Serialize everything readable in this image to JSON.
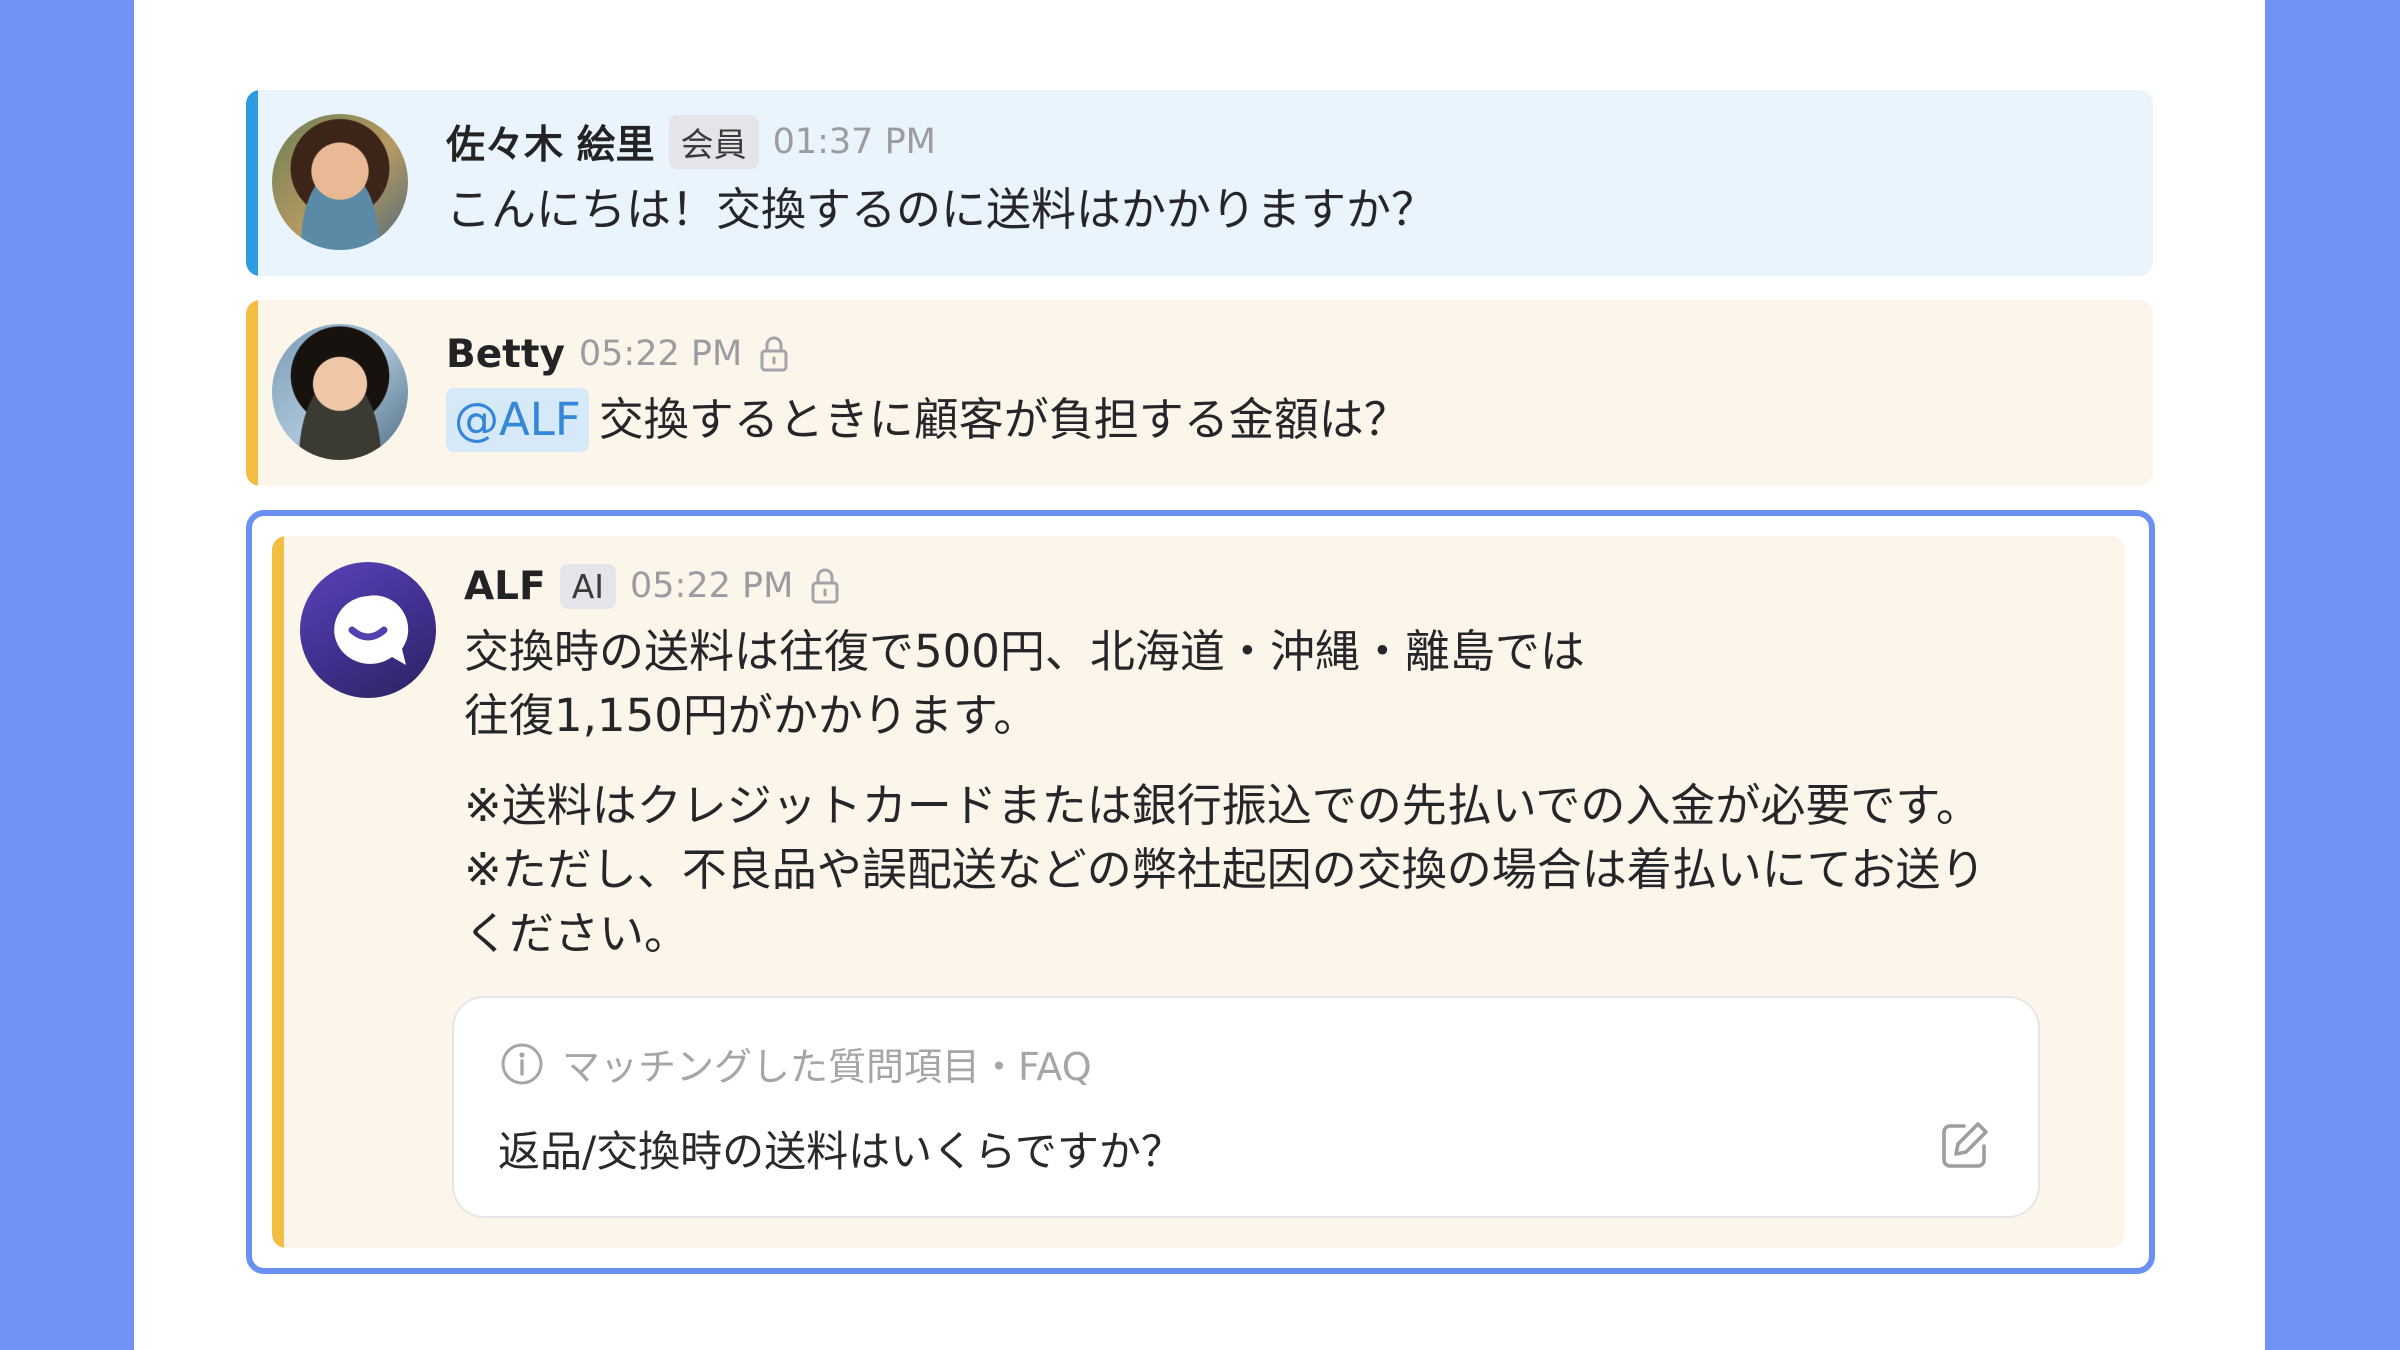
{
  "messages": [
    {
      "author": "佐々木 絵里",
      "badge": "会員",
      "time": "01:37 PM",
      "text": "こんにちは！交換するのに送料はかかりますか？"
    },
    {
      "author": "Betty",
      "time": "05:22 PM",
      "mention": "@ALF",
      "text": "交換するときに顧客が負担する金額は？"
    }
  ],
  "ai_reply": {
    "author": "ALF",
    "badge": "AI",
    "time": "05:22 PM",
    "line1": "交換時の送料は往復で500円、北海道・沖縄・離島では",
    "line2": "往復1,150円がかかります。",
    "note1": "※送料はクレジットカードまたは銀行振込での先払いでの入金が必要です。",
    "note2": "※ただし、不良品や誤配送などの弊社起因の交換の場合は着払いにてお送り",
    "note3": "ください。",
    "faq": {
      "label": "マッチングした質問項目・FAQ",
      "question": "返品/交換時の送料はいくらですか？"
    }
  },
  "colors": {
    "background": "#6f92f4",
    "customer_bar": "#2d9be2",
    "internal_bar": "#f2bf42",
    "focus_border": "#6b90f4"
  },
  "icons": {
    "lock": "lock-icon",
    "info": "info-icon",
    "edit": "edit-icon"
  }
}
